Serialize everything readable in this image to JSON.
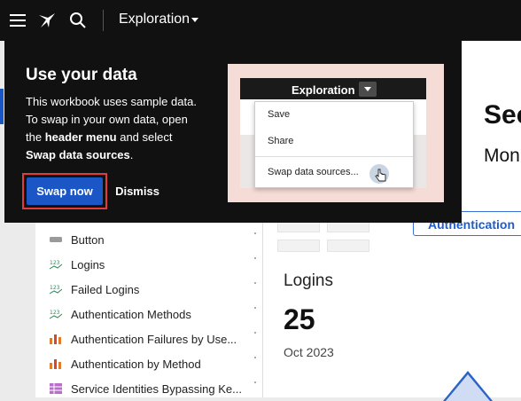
{
  "topbar": {
    "title": "Exploration",
    "icons": [
      "hamburger-menu-icon",
      "sigma-logo-icon",
      "search-icon",
      "chevron-down-icon"
    ]
  },
  "popup": {
    "title": "Use your data",
    "body_line1": "This workbook uses sample data.",
    "body_line2": "To swap in your own data, open",
    "body_the": "the ",
    "body_header_menu": "header menu",
    "body_and_select": " and select",
    "body_swap_sources": "Swap data sources",
    "body_period": ".",
    "swap_now_label": "Swap now",
    "dismiss_label": "Dismiss",
    "illustration": {
      "title": "Exploration",
      "menu_items": [
        "Save",
        "Share",
        "Swap data sources..."
      ]
    },
    "colors": {
      "primary_button": "#1a56c6",
      "highlight_frame": "#e23b3b",
      "illustration_bg": "#f6dcd6"
    }
  },
  "panel": {
    "items": [
      {
        "label": "Button",
        "icon": "button-element-icon"
      },
      {
        "label": "Logins",
        "icon": "kpi-123-icon"
      },
      {
        "label": "Failed Logins",
        "icon": "kpi-123-icon"
      },
      {
        "label": "Authentication Methods",
        "icon": "kpi-123-icon"
      },
      {
        "label": "Authentication Failures by Use...",
        "icon": "bar-chart-icon"
      },
      {
        "label": "Authentication by Method",
        "icon": "bar-chart-icon"
      },
      {
        "label": "Service Identities Bypassing Ke...",
        "icon": "table-icon"
      }
    ]
  },
  "canvas": {
    "heading": "Sec",
    "subheading": "Mon",
    "filter_button_label": "Authentication",
    "kpi": {
      "title": "Logins",
      "value": "25",
      "subtitle": "Oct 2023"
    }
  }
}
